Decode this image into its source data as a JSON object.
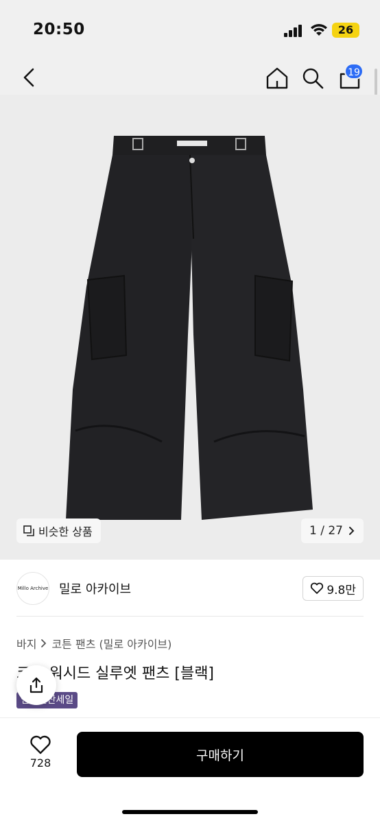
{
  "status_bar": {
    "time": "20:50",
    "battery": "26"
  },
  "header": {
    "cart_count": "19"
  },
  "gallery": {
    "similar_label": "비슷한 상품",
    "counter": "1 / 27"
  },
  "seller": {
    "logo_text": "Millo Archive",
    "name": "밀로 아카이브",
    "like_count": "9.8만"
  },
  "breadcrumb": {
    "level1": "바지",
    "level2": "코튼 팬츠 (밀로 아카이브)"
  },
  "product": {
    "title": "코튼 워시드 실루엣 팬츠 [블랙]",
    "badge": "연말결산세일"
  },
  "bottom": {
    "wish_count": "728",
    "buy_label": "구매하기"
  },
  "colors": {
    "accent_badge": "#2d6cf5",
    "battery": "#f5d312",
    "sale_badge": "#5a4a86",
    "buy_button": "#000000"
  },
  "icons": [
    "back-icon",
    "home-icon",
    "search-icon",
    "cart-icon",
    "similar-icon",
    "chevron-right-icon",
    "heart-icon",
    "share-icon"
  ]
}
